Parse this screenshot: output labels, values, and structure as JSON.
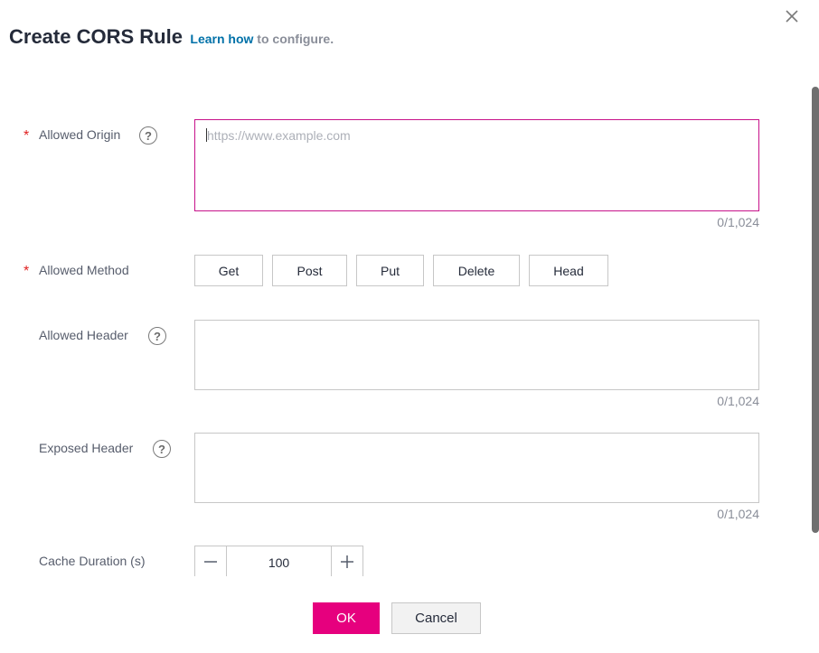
{
  "dialog": {
    "title": "Create CORS Rule",
    "learn_link": "Learn how",
    "learn_rest": " to configure.",
    "close_icon": "close-icon"
  },
  "form": {
    "allowed_origin": {
      "label": "Allowed Origin",
      "required": "*",
      "help": "?",
      "placeholder": "https://www.example.com",
      "value": "",
      "counter": "0/1,024"
    },
    "allowed_method": {
      "label": "Allowed Method",
      "required": "*",
      "options": [
        "Get",
        "Post",
        "Put",
        "Delete",
        "Head"
      ]
    },
    "allowed_header": {
      "label": "Allowed Header",
      "help": "?",
      "value": "",
      "counter": "0/1,024"
    },
    "exposed_header": {
      "label": "Exposed Header",
      "help": "?",
      "value": "",
      "counter": "0/1,024"
    },
    "cache_duration": {
      "label": "Cache Duration (s)",
      "value": "100"
    }
  },
  "footer": {
    "ok_label": "OK",
    "cancel_label": "Cancel"
  },
  "colors": {
    "primary": "#e6007e",
    "focus_border": "#c7128a",
    "link": "#0071a8",
    "required": "#e02020"
  }
}
